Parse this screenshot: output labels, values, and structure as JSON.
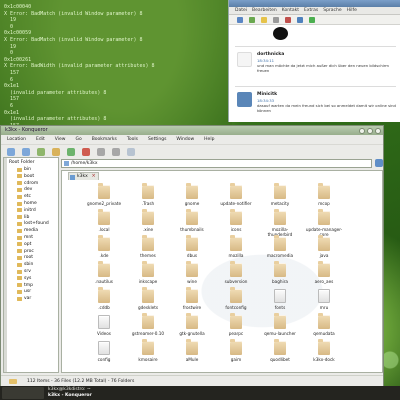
{
  "terminal": {
    "lines": [
      "0x1c00040",
      "X Error: BadMatch (invalid Window parameter) 8",
      "  19",
      "  0",
      "0x1c00059",
      "X Error: BadMatch (invalid Window parameter) 8",
      "  19",
      "  0",
      "0x1c00261",
      "X Error: BadWidth (invalid parameter attributes) 8",
      "  157",
      "  6",
      "0x1e1",
      "  (invalid parameter attributes) 8",
      "  157",
      "  6",
      "0x1e1",
      "  (invalid parameter attributes) 8",
      "  157",
      "  6",
      "0x1e1"
    ]
  },
  "chat": {
    "menu": [
      "Datei",
      "Bearbeiten",
      "Kontakt",
      "Extras",
      "Sprache",
      "Hilfe"
    ],
    "messages": [
      {
        "name": "dorthnicka",
        "time": "18:34:11",
        "text": "und man möchte da jetzt mich außer dich über den neuen bildschirm freuen",
        "avatar": "#f3f3f3"
      },
      {
        "name": "Minicitk",
        "time": "18:34:33",
        "text": "dasauf warten da mein freund sich bei so anmeldet damit wir online sind können",
        "avatar": "#5a86b8"
      }
    ]
  },
  "konqueror": {
    "title": "k3kx - Konqueror",
    "menu": [
      "Location",
      "Edit",
      "View",
      "Go",
      "Bookmarks",
      "Tools",
      "Settings",
      "Window",
      "Help"
    ],
    "location": "/home/k3kx",
    "tab": "k3kx",
    "tree": {
      "root": "Root Folder",
      "items": [
        "bin",
        "boot",
        "cdrom",
        "dev",
        "etc",
        "home",
        "initrd",
        "lib",
        "lost+found",
        "media",
        "mnt",
        "opt",
        "proc",
        "root",
        "sbin",
        "srv",
        "sys",
        "tmp",
        "usr",
        "var"
      ]
    },
    "files": [
      [
        "gnome2_private",
        ".Trash",
        "gnome",
        "update-notifier",
        "metacity",
        "mcop"
      ],
      [
        ".local",
        ".xine",
        "thumbnails",
        "icons",
        "mozilla-thunderbird",
        "update-manager-core"
      ],
      [
        ".kde",
        "themes",
        "dbus",
        "mozilla",
        "macromedia",
        "java"
      ],
      [
        ".nautilus",
        "inkscape",
        "wine",
        "subversion",
        "baghira",
        "aero_aes"
      ],
      [
        ".cddb",
        "gdeskle​ts",
        "frostwire",
        "fontconfig",
        "fonts",
        "mru"
      ],
      [
        "Videos",
        "gstreamer-0.10",
        "gtk-gnutella",
        "pearpc",
        "qemu-launcher",
        "qemudata"
      ],
      [
        "config",
        "kmosaire",
        "aMule",
        "gaim",
        "quodlibet",
        "k3kx-dock"
      ]
    ],
    "status": "112 Items - 36 Files (12.2 MB Total) - 76 Folders"
  },
  "taskbar": {
    "items": [
      "k3kx@k3kdistro: ~",
      "k3kx - Konqueror"
    ]
  }
}
